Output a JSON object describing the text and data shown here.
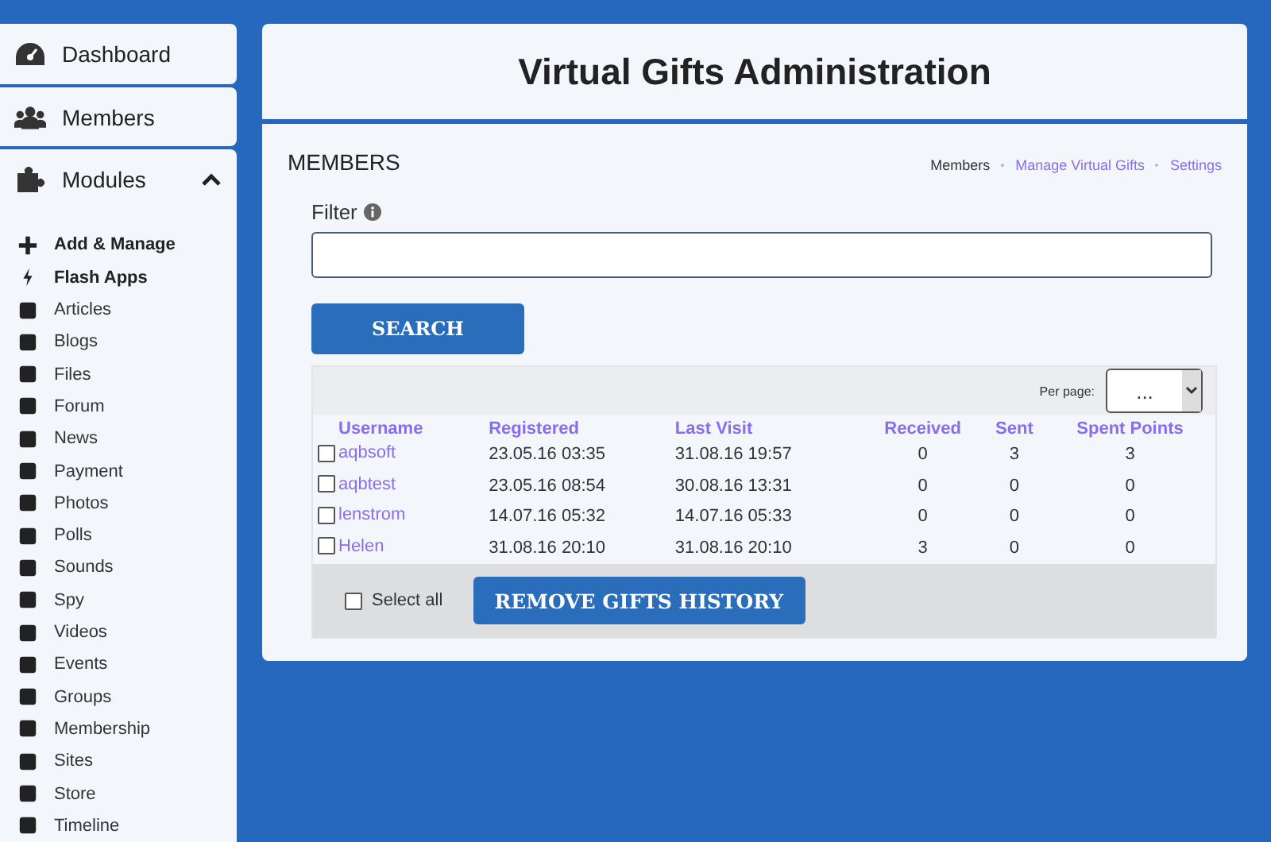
{
  "sidebar": {
    "items": [
      {
        "label": "Dashboard"
      },
      {
        "label": "Members"
      }
    ],
    "modules": {
      "label": "Modules",
      "expanded": true,
      "items": [
        {
          "label": "Add & Manage",
          "kind": "action"
        },
        {
          "label": "Flash Apps",
          "kind": "action"
        },
        {
          "label": "Articles",
          "kind": "module"
        },
        {
          "label": "Blogs",
          "kind": "module"
        },
        {
          "label": "Files",
          "kind": "module"
        },
        {
          "label": "Forum",
          "kind": "module"
        },
        {
          "label": "News",
          "kind": "module"
        },
        {
          "label": "Payment",
          "kind": "module"
        },
        {
          "label": "Photos",
          "kind": "module"
        },
        {
          "label": "Polls",
          "kind": "module"
        },
        {
          "label": "Sounds",
          "kind": "module"
        },
        {
          "label": "Spy",
          "kind": "module"
        },
        {
          "label": "Videos",
          "kind": "module"
        },
        {
          "label": "Events",
          "kind": "module"
        },
        {
          "label": "Groups",
          "kind": "module"
        },
        {
          "label": "Membership",
          "kind": "module"
        },
        {
          "label": "Sites",
          "kind": "module"
        },
        {
          "label": "Store",
          "kind": "module"
        },
        {
          "label": "Timeline",
          "kind": "module"
        }
      ]
    }
  },
  "header": {
    "title": "Virtual Gifts Administration"
  },
  "section": {
    "title": "MEMBERS",
    "tabs": [
      {
        "label": "Members",
        "selected": true
      },
      {
        "label": "Manage Virtual Gifts",
        "selected": false
      },
      {
        "label": "Settings",
        "selected": false
      }
    ]
  },
  "filter": {
    "label": "Filter"
  },
  "search_button": "SEARCH",
  "per_page": {
    "label": "Per page:",
    "value": "..."
  },
  "table": {
    "columns": [
      "Username",
      "Registered",
      "Last Visit",
      "Received",
      "Sent",
      "Spent Points"
    ],
    "rows": [
      {
        "checked": false,
        "cells": [
          "aqbsoft",
          "23.05.16 03:35",
          "31.08.16 19:57",
          "0",
          "3",
          "3"
        ]
      },
      {
        "checked": false,
        "cells": [
          "aqbtest",
          "23.05.16 08:54",
          "30.08.16 13:31",
          "0",
          "0",
          "0"
        ]
      },
      {
        "checked": false,
        "cells": [
          "lenstrom",
          "14.07.16 05:32",
          "14.07.16 05:33",
          "0",
          "0",
          "0"
        ]
      },
      {
        "checked": false,
        "cells": [
          "Helen",
          "31.08.16 20:10",
          "31.08.16 20:10",
          "3",
          "0",
          "0"
        ]
      }
    ]
  },
  "select_all": {
    "label": "Select all",
    "checked": false
  },
  "remove_button": "REMOVE GIFTS HISTORY"
}
